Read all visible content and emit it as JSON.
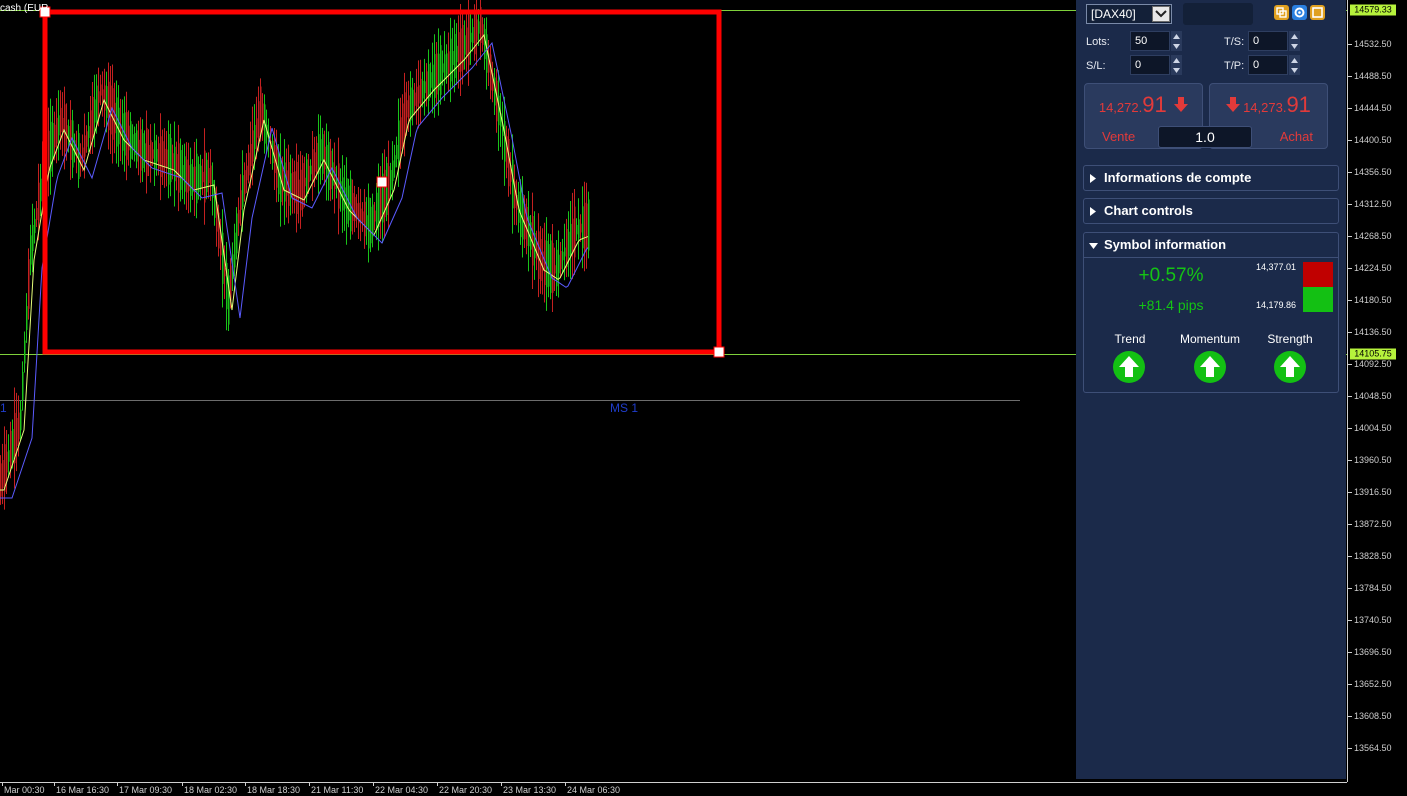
{
  "chart": {
    "symbol_title": "cash (EUR",
    "ms_label": "MS 1",
    "left_mark": "1",
    "colors": {
      "background": "#000000",
      "up_candle": "#19c219",
      "down_candle": "#c42020",
      "box": "#ff0000",
      "ma_fast": "#e6ff7a",
      "ma_slow": "#5b5bff",
      "level_line": "#7fd13b"
    }
  },
  "price_axis": {
    "labels": [
      "14532.50",
      "14488.50",
      "14444.50",
      "14400.50",
      "14356.50",
      "14312.50",
      "14268.50",
      "14224.50",
      "14180.50",
      "14136.50",
      "14092.50",
      "14048.50",
      "14004.50",
      "13960.50",
      "13916.50",
      "13872.50",
      "13828.50",
      "13784.50",
      "13740.50",
      "13696.50",
      "13652.50",
      "13608.50",
      "13564.50"
    ],
    "tag_top": "14579.33",
    "tag_bottom": "14105.75"
  },
  "time_axis": {
    "labels": [
      "Mar 00:30",
      "16 Mar 16:30",
      "17 Mar 09:30",
      "18 Mar 02:30",
      "18 Mar 18:30",
      "21 Mar 11:30",
      "22 Mar 04:30",
      "22 Mar 20:30",
      "23 Mar 13:30",
      "24 Mar 06:30"
    ]
  },
  "panel": {
    "symbol_value": "[DAX40]",
    "search_value": "",
    "lots_label": "Lots:",
    "lots_value": "50",
    "sl_label": "S/L:",
    "sl_value": "0",
    "ts_label": "T/S:",
    "ts_value": "0",
    "tp_label": "T/P:",
    "tp_value": "0",
    "sell": {
      "price_small": "14,272.",
      "price_big": "91",
      "label": "Vente"
    },
    "buy": {
      "price_small": "14,273.",
      "price_big": "91",
      "label": "Achat"
    },
    "lot_size": "1.0",
    "sections": {
      "account": "Informations de compte",
      "chart_controls": "Chart controls",
      "symbol_info": "Symbol information"
    },
    "symbol_info": {
      "pct_change": "+0.57%",
      "pips_change": "+81.4 pips",
      "high": "14,377.01",
      "low": "14,179.86",
      "indicators": [
        "Trend",
        "Momentum",
        "Strength"
      ]
    },
    "icons": [
      "copy-icon",
      "settings-icon",
      "window-icon"
    ]
  }
}
